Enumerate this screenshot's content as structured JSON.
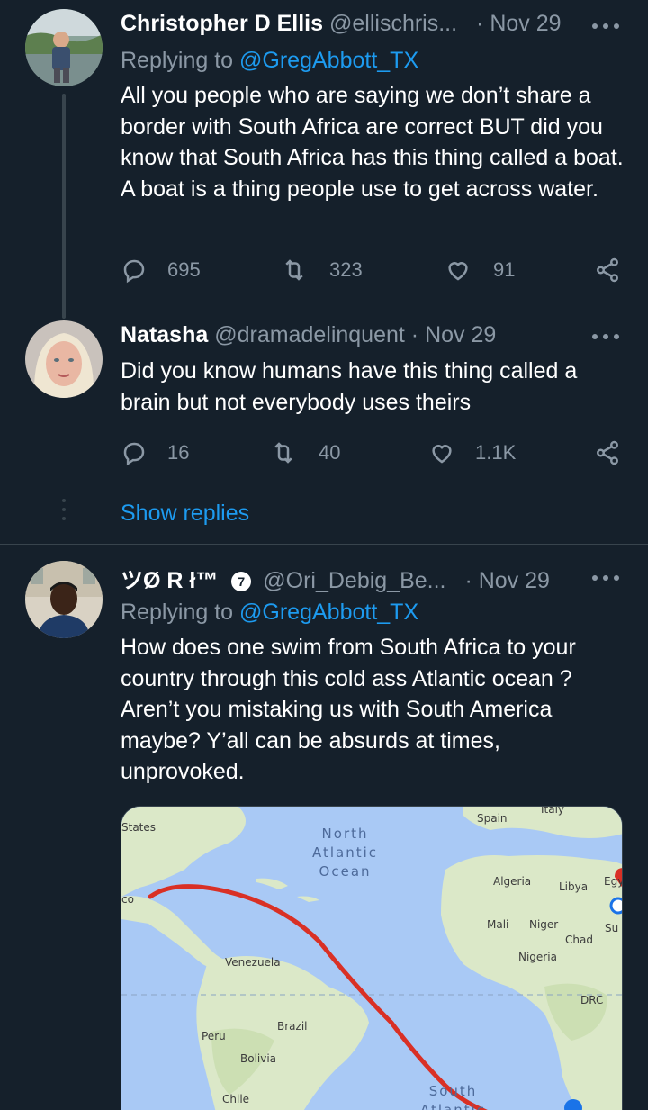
{
  "tweets": [
    {
      "name": "Christopher D Ellis",
      "handle": "@ellischris...",
      "dot": "·",
      "date": "Nov 29",
      "replying_prefix": "Replying to",
      "replying_to": "@GregAbbott_TX",
      "text": "All you people who are saying we don’t share a border with South Africa are correct BUT did you know that South Africa has this thing called a boat. A boat is a thing people use to get across water.",
      "replies": "695",
      "retweets": "323",
      "likes": "91"
    },
    {
      "name": "Natasha",
      "handle": "@dramadelinquent",
      "dot": "·",
      "date": "Nov 29",
      "text": "Did you know humans have this thing called a brain but not everybody uses theirs",
      "replies": "16",
      "retweets": "40",
      "likes": "1.1K",
      "show_replies": "Show replies"
    },
    {
      "name": "ツØ R ł™",
      "badge": "7",
      "handle": "@Ori_Debig_Be...",
      "dot": "·",
      "date": "Nov 29",
      "replying_prefix": "Replying to",
      "replying_to": "@GregAbbott_TX",
      "text": "How does one swim from South Africa to your country through this cold ass Atlantic ocean ? Aren’t you mistaking us with South America maybe? Y’all can be absurds at times, unprovoked."
    }
  ],
  "map": {
    "ocean_north": "North\nAtlantic\nOcean",
    "ocean_south": "South\nAtlantic",
    "labels": {
      "states": "States",
      "co": "co",
      "spain": "Spain",
      "italy": "Italy",
      "algeria": "Algeria",
      "libya": "Libya",
      "egypt": "Egy",
      "mali": "Mali",
      "niger": "Niger",
      "chad": "Chad",
      "sudan": "Su",
      "nigeria": "Nigeria",
      "drc": "DRC",
      "venezuela": "Venezuela",
      "peru": "Peru",
      "brazil": "Brazil",
      "bolivia": "Bolivia",
      "chile": "Chile"
    },
    "route_color": "#d93025",
    "land_color": "#dbe8c8",
    "water_color": "#a9c9f5"
  },
  "colors": {
    "background": "#15202b",
    "secondary_text": "#8b98a5",
    "accent": "#1d9bf0",
    "divider": "#38444d"
  },
  "icons": {
    "reply": "reply-icon",
    "retweet": "retweet-icon",
    "like": "heart-icon",
    "share": "share-icon",
    "more": "more-icon"
  }
}
